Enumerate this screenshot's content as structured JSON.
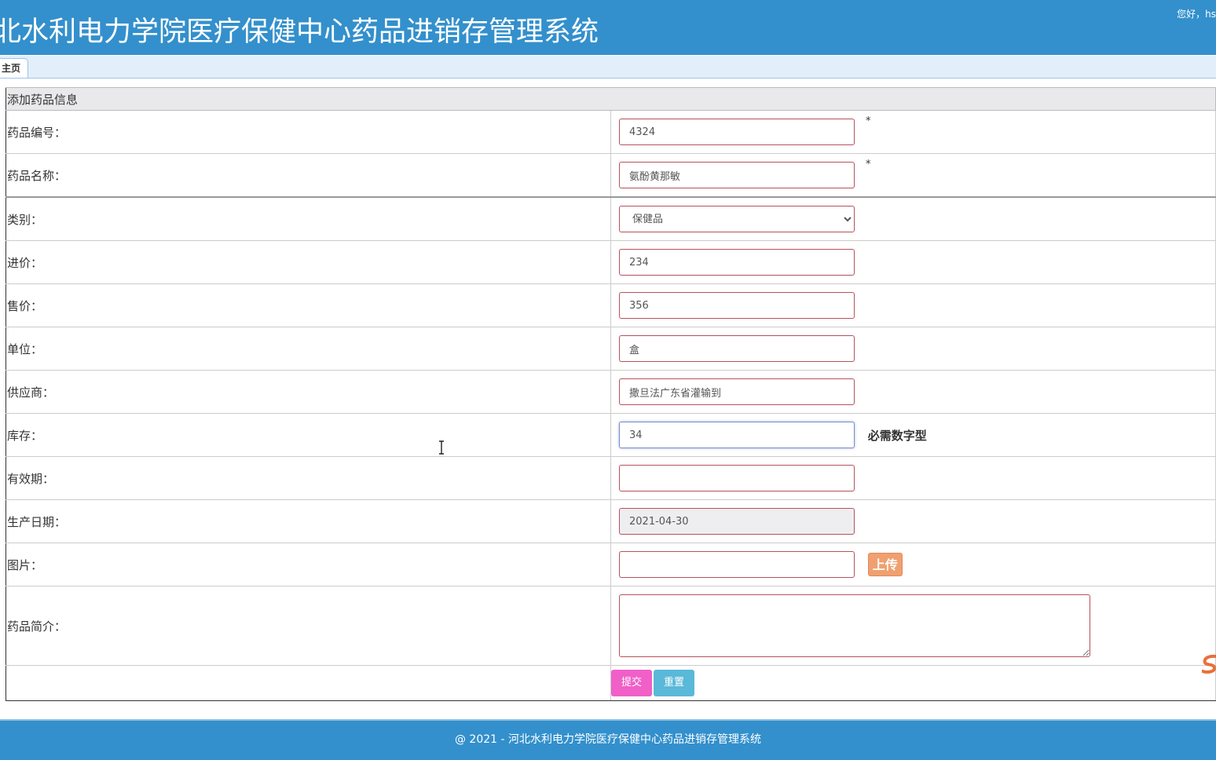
{
  "header": {
    "title": "北水利电力学院医疗保健中心药品进销存管理系统",
    "greeting": "您好，hs"
  },
  "tabs": [
    {
      "label": "主页"
    }
  ],
  "form": {
    "caption": "添加药品信息",
    "fields": {
      "code": {
        "label": "药品编号：",
        "value": "4324",
        "required": "*"
      },
      "name": {
        "label": "药品名称：",
        "value": "氨酚黄那敏",
        "required": "*"
      },
      "category": {
        "label": "类别：",
        "value": "保健品"
      },
      "purchase_price": {
        "label": "进价：",
        "value": "234"
      },
      "sale_price": {
        "label": "售价：",
        "value": "356"
      },
      "unit": {
        "label": "单位：",
        "value": "盒"
      },
      "supplier": {
        "label": "供应商：",
        "value": "撒旦法广东省灌输到"
      },
      "stock": {
        "label": "库存：",
        "value": "34",
        "hint": "必需数字型"
      },
      "expiry": {
        "label": "有效期：",
        "value": ""
      },
      "production_date": {
        "label": "生产日期：",
        "value": "2021-04-30"
      },
      "image": {
        "label": "图片：",
        "value": "",
        "upload_label": "上传"
      },
      "description": {
        "label": "药品简介：",
        "value": ""
      }
    },
    "buttons": {
      "submit": "提交",
      "reset": "重置"
    }
  },
  "footer": {
    "copyright": "@ 2021 - 河北水利电力学院医疗保健中心药品进销存管理系统"
  },
  "colors": {
    "header_bg": "#3390cc",
    "submit": "#f060c8",
    "reset": "#5ab8d8",
    "upload": "#f0a070"
  }
}
